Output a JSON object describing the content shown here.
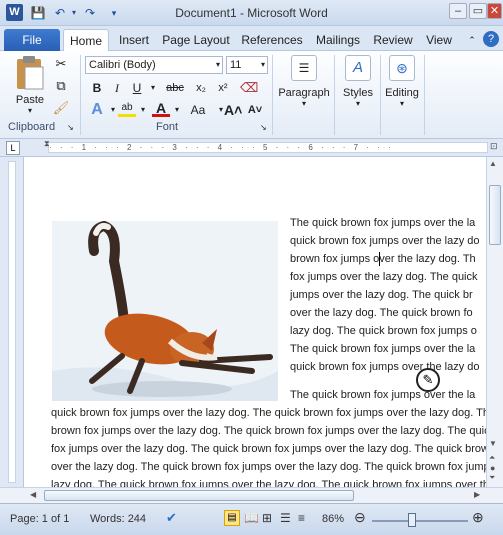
{
  "window": {
    "title": "Document1 - Microsoft Word"
  },
  "quick_access": [
    "save-icon",
    "undo-icon",
    "redo-icon",
    "customize-icon"
  ],
  "tabs": [
    "File",
    "Home",
    "Insert",
    "Page Layout",
    "References",
    "Mailings",
    "Review",
    "View"
  ],
  "ribbon": {
    "paste_label": "Paste",
    "font_name": "Calibri (Body)",
    "font_size": "11",
    "paragraph_label": "Paragraph",
    "styles_label": "Styles",
    "editing_label": "Editing",
    "groups": {
      "clipboard": "Clipboard",
      "font": "Font"
    }
  },
  "document": {
    "right_lines": [
      "The quick brown fox jumps over the la",
      "quick brown fox jumps over the lazy do",
      "brown fox jumps over the lazy dog. Th",
      "fox jumps over the lazy dog. The quick",
      "jumps over the lazy dog. The quick br",
      "over the lazy dog. The quick brown fo",
      "lazy dog. The quick brown fox jumps o",
      "The quick brown fox jumps over the la",
      "quick brown fox jumps over the lazy do"
    ],
    "para2_first": "The quick brown fox jumps over the la",
    "full_lines": [
      "quick brown fox jumps over the lazy dog. The quick brown fox jumps over the lazy dog. The",
      "brown fox jumps over the lazy dog. The quick brown fox jumps over the lazy dog. The quick",
      "fox jumps over the lazy dog. The quick brown fox jumps over the lazy dog. The quick brown",
      "over the lazy dog. The quick brown fox jumps over the lazy dog. The quick brown fox jumps",
      "lazy dog. The quick brown fox jumps over the lazy dog. The quick brown fox jumps over the"
    ]
  },
  "status": {
    "page": "Page: 1 of 1",
    "words": "Words: 244",
    "zoom": "86%"
  }
}
